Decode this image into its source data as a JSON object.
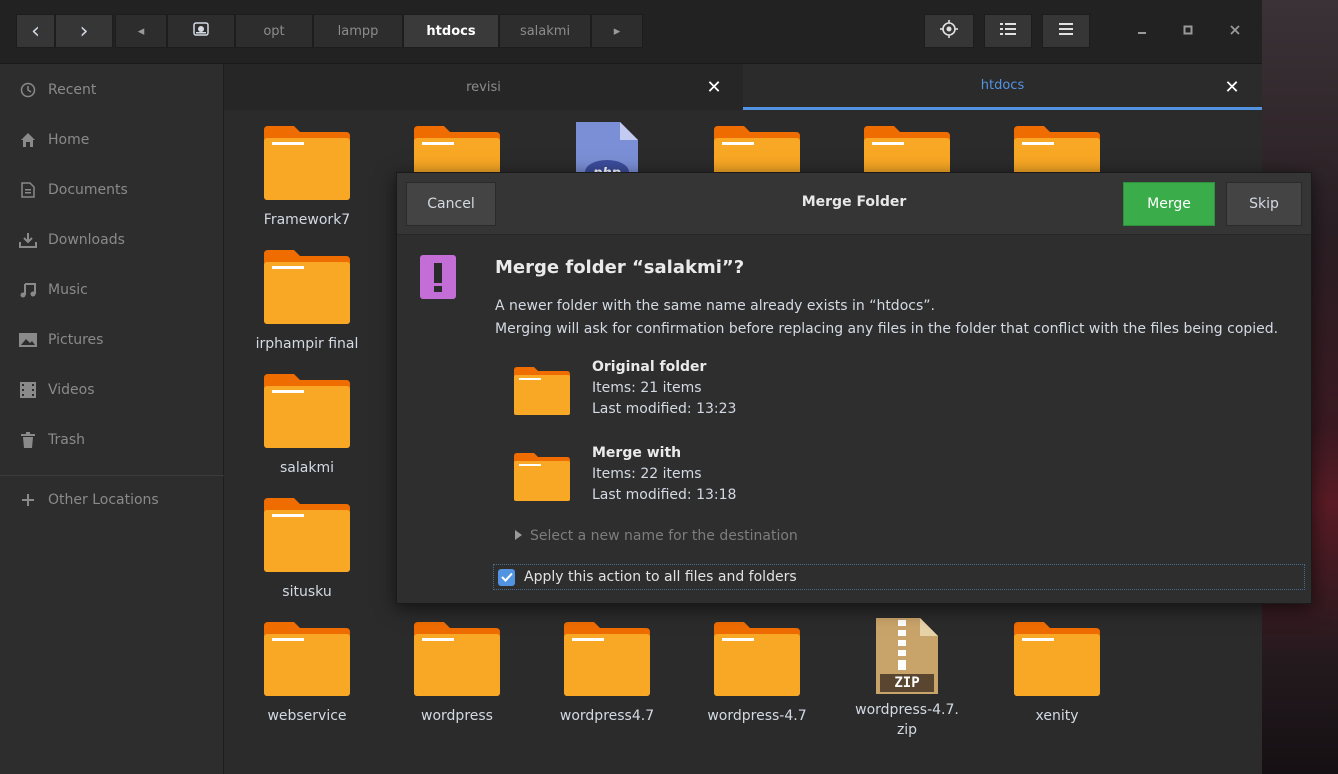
{
  "headerbar": {
    "back_label": "‹",
    "forward_label": "›",
    "path_left_arrow": "◂",
    "path": [
      "opt",
      "lampp",
      "htdocs",
      "salakmi"
    ],
    "path_active_index": 2,
    "path_right_arrow": "▸"
  },
  "sidebar": {
    "items": [
      {
        "label": "Recent",
        "icon": "clock-icon"
      },
      {
        "label": "Home",
        "icon": "home-icon"
      },
      {
        "label": "Documents",
        "icon": "document-icon"
      },
      {
        "label": "Downloads",
        "icon": "download-icon"
      },
      {
        "label": "Music",
        "icon": "music-icon"
      },
      {
        "label": "Pictures",
        "icon": "picture-icon"
      },
      {
        "label": "Videos",
        "icon": "video-icon"
      },
      {
        "label": "Trash",
        "icon": "trash-icon"
      }
    ],
    "other_locations": "Other Locations"
  },
  "tabs": [
    {
      "label": "revisi",
      "active": false
    },
    {
      "label": "htdocs",
      "active": true
    }
  ],
  "files": {
    "col1": [
      "Framework7",
      "irphampir final",
      "salakmi",
      "situsku"
    ],
    "bottom_row": [
      "webservice",
      "wordpress",
      "wordpress4.7",
      "wordpress-4.7",
      "wordpress-4.7.\nzip",
      "xenity"
    ],
    "zip_label": "ZIP"
  },
  "dialog": {
    "cancel": "Cancel",
    "title": "Merge Folder",
    "merge": "Merge",
    "skip": "Skip",
    "heading": "Merge folder “salakmi”?",
    "line1": "A newer folder with the same name already exists in “htdocs”.",
    "line2": "Merging will ask for confirmation before replacing any files in the folder that conflict with the files being copied.",
    "original": {
      "title": "Original folder",
      "items": "Items: 21 items",
      "modified": "Last modified: 13:23"
    },
    "merge_with": {
      "title": "Merge with",
      "items": "Items: 22 items",
      "modified": "Last modified: 13:18"
    },
    "expander": "Select a new name for the destination",
    "apply_all": "Apply this action to all files and folders",
    "apply_all_checked": true
  },
  "colors": {
    "accent": "#5294e2",
    "merge_green": "#3aad4a",
    "folder_orange": "#f9a825",
    "folder_tab": "#ef6c00",
    "warn_purple": "#c36ed7"
  }
}
